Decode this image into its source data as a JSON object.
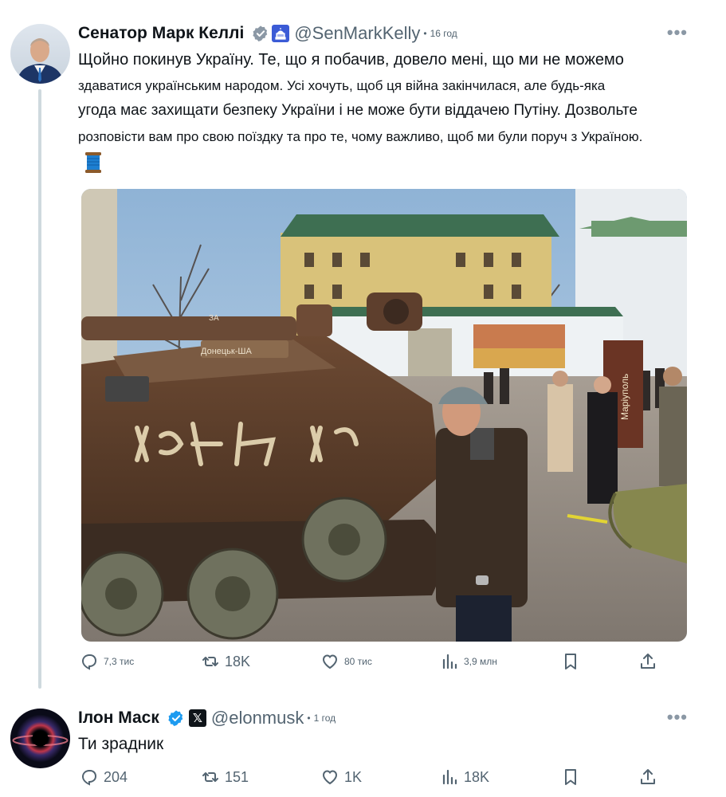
{
  "tweets": [
    {
      "author": {
        "name": "Сенатор Марк Келлі",
        "handle": "@SenMarkKelly",
        "time": "16 год",
        "verified": true,
        "badge": "us-capitol-icon"
      },
      "text_lines": [
        "Щойно покинув Україну. Те, що я побачив, довело мені, що ми не можемо",
        "здаватися українським народом. Усі хочуть, щоб ця війна закінчилася, але будь-яка",
        "угода має захищати безпеку України і не може бути віддачею Путіну. Дозвольте",
        "розповісти вам про свою поїздку та про те, чому важливо, щоб ми були поруч з Україною."
      ],
      "emoji": "thread-spool-icon",
      "photo_labels": {
        "tank": "Донецьк-ША",
        "sign": "Маріуполь",
        "turret": "ЗА"
      },
      "stats": {
        "replies": "7,3 тис",
        "retweets": "18K",
        "likes": "80 тис",
        "views": "3,9 млн"
      }
    },
    {
      "author": {
        "name": "Ілон Маск",
        "handle": "@elonmusk",
        "time": "1 год",
        "verified": true,
        "badge": "x-logo-icon"
      },
      "text": "Ти зрадник",
      "stats": {
        "replies": "204",
        "retweets": "151",
        "likes": "1K",
        "views": "18K"
      }
    }
  ],
  "ui": {
    "more_label": "•••",
    "dot": "•",
    "x_glyph": "𝕏"
  },
  "colors": {
    "verified": "#1d9bf0",
    "gov_badge": "#3b5bd6",
    "thread_line": "#cfd9de",
    "muted": "#536471"
  }
}
